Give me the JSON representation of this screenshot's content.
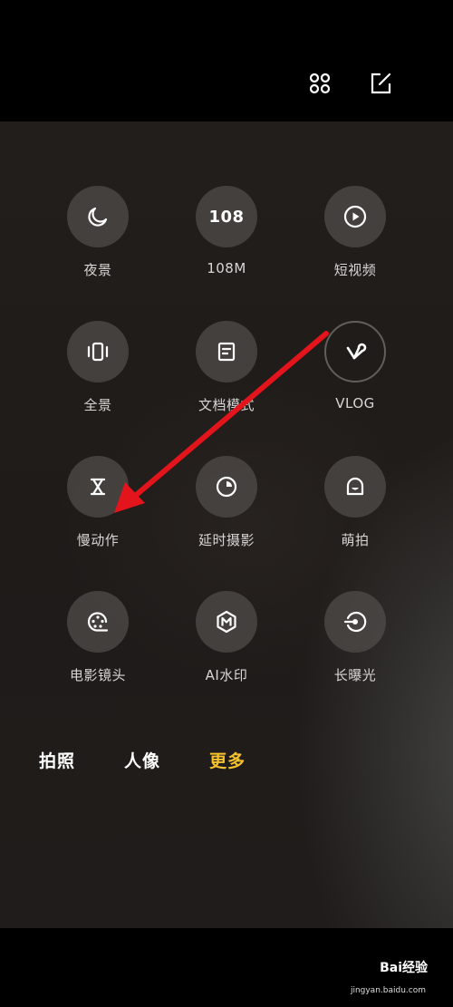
{
  "header": {
    "icons": [
      "grid-four-dots-icon",
      "edit-square-icon"
    ]
  },
  "modes": [
    {
      "id": "night",
      "label": "夜景",
      "icon": "moon-icon"
    },
    {
      "id": "108m",
      "label": "108M",
      "icon_text": "108"
    },
    {
      "id": "short-video",
      "label": "短视频",
      "icon": "play-circle-icon"
    },
    {
      "id": "panorama",
      "label": "全景",
      "icon": "panorama-icon"
    },
    {
      "id": "document",
      "label": "文档模式",
      "icon": "document-icon"
    },
    {
      "id": "vlog",
      "label": "VLOG",
      "icon": "vlog-v-icon"
    },
    {
      "id": "slow-motion",
      "label": "慢动作",
      "icon": "hourglass-icon"
    },
    {
      "id": "timelapse",
      "label": "延时摄影",
      "icon": "timer-pie-icon"
    },
    {
      "id": "cute-shot",
      "label": "萌拍",
      "icon": "cute-face-icon"
    },
    {
      "id": "movie",
      "label": "电影镜头",
      "icon": "film-reel-icon"
    },
    {
      "id": "ai-watermark",
      "label": "AI水印",
      "icon": "m-hexagon-icon"
    },
    {
      "id": "long-exposure",
      "label": "长曝光",
      "icon": "exposure-target-icon"
    }
  ],
  "tabs": [
    {
      "label": "拍照",
      "active": false
    },
    {
      "label": "人像",
      "active": false
    },
    {
      "label": "更多",
      "active": true
    }
  ],
  "colors": {
    "accent": "#f5c22e",
    "annotation_arrow": "#e3141b"
  },
  "watermark": {
    "brand": "Bai经验",
    "url": "jingyan.baidu.com"
  }
}
